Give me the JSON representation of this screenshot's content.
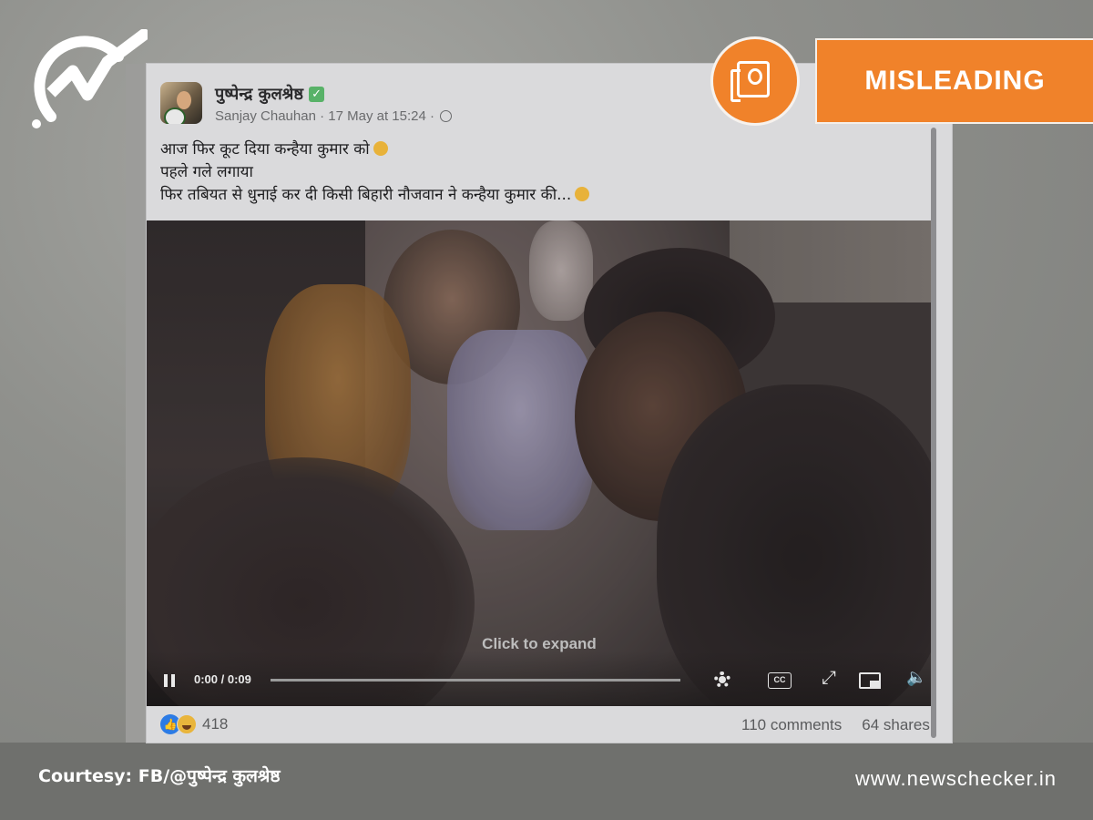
{
  "post": {
    "author": "पुष्पेन्द्र कुलश्रेष्ठ",
    "meta_text": "Sanjay Chauhan · 17 May at 15:24 ·",
    "lines": [
      "आज फिर कूट दिया कन्हैया कुमार को",
      "पहले गले लगाया",
      "फिर तबियत से धुनाई कर दी किसी बिहारी नौजवान ने कन्हैया कुमार की..."
    ],
    "reaction_count": "418",
    "comments": "110 comments",
    "shares": "64 shares"
  },
  "video": {
    "expand_hint": "Click to expand",
    "time": "0:00 / 0:09",
    "progress": 0.0,
    "cc_label": "CC"
  },
  "overlay": {
    "verdict": "MISLEADING",
    "courtesy": "Courtesy: FB/@पुष्पेन्द्र कुलश्रेष्ठ",
    "site": "www.newschecker.in"
  },
  "colors": {
    "accent": "#f0822a",
    "verified": "#58b268",
    "like": "#2c7be5"
  },
  "icons": [
    "newschecker-logo-icon",
    "verified-icon",
    "globe-icon",
    "pause-icon",
    "settings-icon",
    "captions-icon",
    "fullscreen-icon",
    "pip-icon",
    "volume-icon",
    "like-reaction-icon",
    "haha-reaction-icon",
    "fact-check-badge-icon"
  ]
}
